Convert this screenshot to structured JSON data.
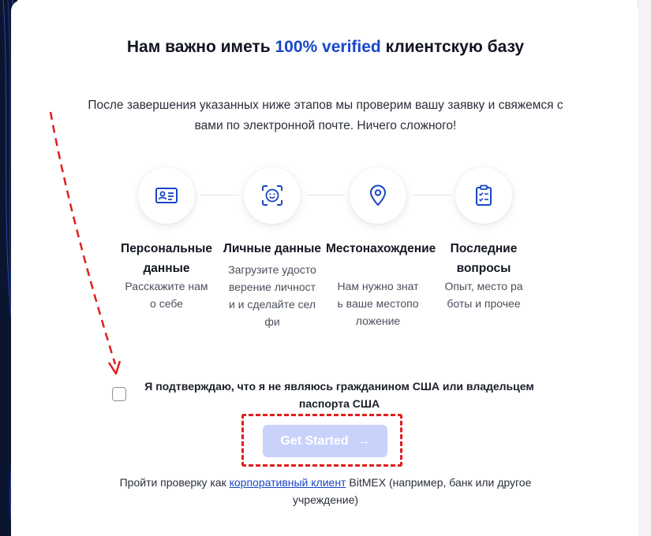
{
  "title": {
    "before": "Нам важно иметь ",
    "accent": "100% verified",
    "after": " клиентскую базу"
  },
  "subtitle": "После завершения указанных ниже этапов мы проверим вашу заявку и свяжемся с вами по электронной почте. Ничего сложного!",
  "steps": [
    {
      "icon": "id-card-icon",
      "title": "Персональные данные",
      "desc": "Расскажите нам о себе"
    },
    {
      "icon": "face-scan-icon",
      "title": "Личные данные",
      "desc": "Загрузите удостоверение личности и сделайте селфи"
    },
    {
      "icon": "location-pin-icon",
      "title": "Местонахождение",
      "desc": "Нам нужно знать ваше местоположение"
    },
    {
      "icon": "clipboard-check-icon",
      "title": "Последние вопросы",
      "desc": "Опыт, место работы и прочее"
    }
  ],
  "confirm": {
    "label": "Я подтверждаю, что я не являюсь гражданином США или владельцем паспорта США",
    "checked": false
  },
  "button": {
    "label": "Get Started",
    "arrow": "→"
  },
  "footer": {
    "before": "Пройти проверку как ",
    "link": "корпоративный клиент",
    "after": " BitMEX (например, банк или другое учреждение)"
  },
  "colors": {
    "accent": "#1946c8",
    "button_disabled": "#c9d2fb",
    "annotation_red": "#e01e1e"
  }
}
